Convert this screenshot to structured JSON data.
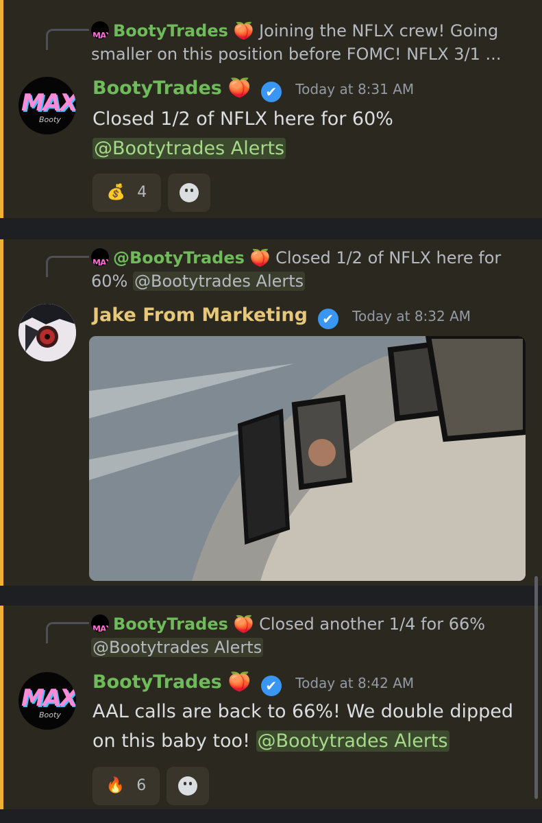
{
  "messages": [
    {
      "reply": {
        "author": "BootyTrades",
        "emoji": "🍑",
        "text": "Joining the NFLX crew! Going smaller on this position before FOMC!  NFLX 3/1 ..."
      },
      "author": "BootyTrades",
      "emoji": "🍑",
      "timestamp": "Today at 8:31 AM",
      "text": "Closed 1/2 of NFLX here for 60%",
      "mention": "@Bootytrades Alerts",
      "reaction": {
        "emoji": "💰",
        "count": "4"
      }
    },
    {
      "reply": {
        "author": "@BootyTrades",
        "emoji": "🍑",
        "text": "Closed 1/2 of NFLX here for",
        "text2": "60%",
        "mention": "@Bootytrades Alerts"
      },
      "author": "Jake From Marketing",
      "timestamp": "Today at 8:32 AM"
    },
    {
      "reply": {
        "author": "BootyTrades",
        "emoji": "🍑",
        "text": "Closed another 1/4 for 66%",
        "mention": "@Bootytrades Alerts"
      },
      "author": "BootyTrades",
      "emoji": "🍑",
      "timestamp": "Today at 8:42 AM",
      "text": "AAL calls are back to 66%! We double dipped on this baby too!",
      "mention": "@Bootytrades Alerts",
      "reaction": {
        "emoji": "🔥",
        "count": "6"
      }
    }
  ],
  "avatar_logo": {
    "main": "MAX",
    "sub": "Booty"
  },
  "icons": {
    "verified": "verified-badge-icon",
    "add_reaction": "add-reaction-icon"
  },
  "colors": {
    "accent_bar": "#f0b232",
    "author_green": "#6fba5a",
    "author_gold": "#e7c77a",
    "verified_blue": "#3a96f3"
  }
}
